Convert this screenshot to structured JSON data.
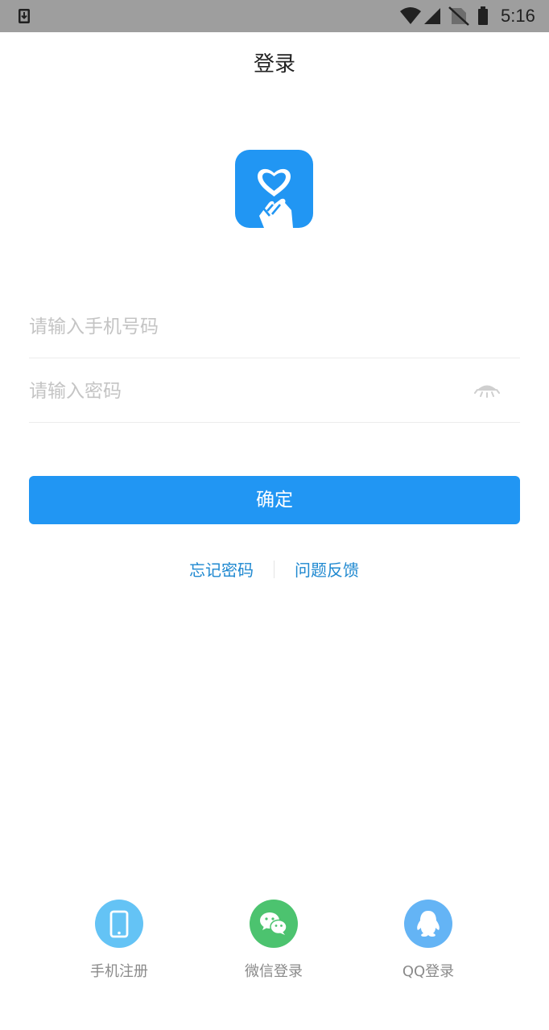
{
  "status_bar": {
    "time": "5:16",
    "icons": [
      "download-icon",
      "wifi-icon",
      "cell-signal-icon",
      "no-sim-icon",
      "battery-icon"
    ]
  },
  "header": {
    "title": "登录"
  },
  "logo": {
    "icon": "heart-hand-icon",
    "color": "#2196f3"
  },
  "form": {
    "phone_placeholder": "请输入手机号码",
    "password_placeholder": "请输入密码",
    "password_toggle_icon": "eye-closed-icon",
    "submit_label": "确定"
  },
  "links": {
    "forgot": "忘记密码",
    "feedback": "问题反馈"
  },
  "social": {
    "phone": {
      "label": "手机注册",
      "icon": "phone-icon",
      "color": "#64c3f5"
    },
    "wechat": {
      "label": "微信登录",
      "icon": "wechat-icon",
      "color": "#4cc36f"
    },
    "qq": {
      "label": "QQ登录",
      "icon": "qq-icon",
      "color": "#64b4f5"
    }
  },
  "colors": {
    "accent": "#2196f3",
    "link": "#1e88d0"
  }
}
